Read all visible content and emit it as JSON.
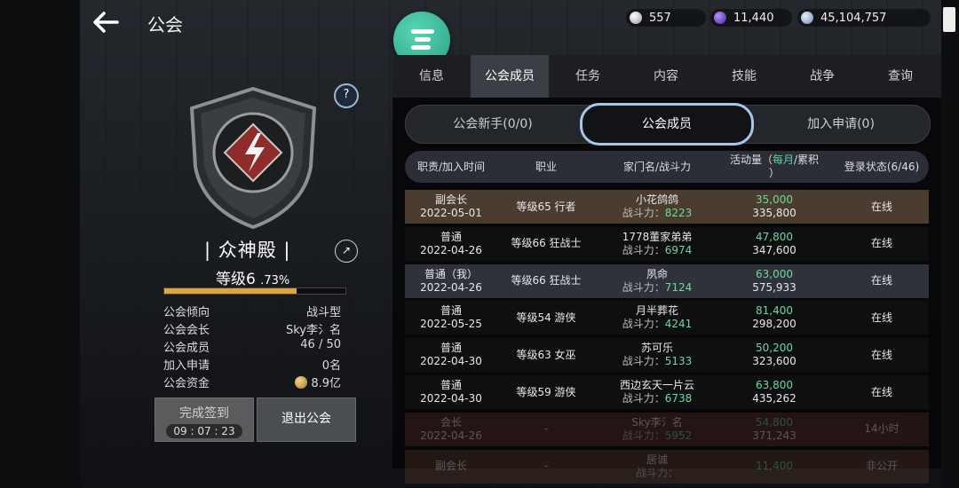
{
  "header": {
    "title": "公会",
    "currencies": [
      {
        "icon": "silver-coin-icon",
        "value": "557",
        "color": "#d8d8d8"
      },
      {
        "icon": "purple-gem-icon",
        "value": "11,440",
        "color": "#7a4bd6"
      },
      {
        "icon": "blue-coin-icon",
        "value": "45,104,757",
        "color": "#a9c0dc"
      }
    ]
  },
  "guild": {
    "name": "| 众神殿 |",
    "level": "等级6",
    "level_pct": ".73%",
    "xp_fraction": 0.73,
    "info": [
      {
        "k": "公会倾向",
        "v": "战斗型"
      },
      {
        "k": "公会会长",
        "v": "Sky李氵名"
      },
      {
        "k": "公会成员",
        "v": "46 / 50"
      },
      {
        "k": "加入申请",
        "v": "0名"
      },
      {
        "k": "公会资金",
        "v": "8.9亿"
      }
    ],
    "checkin_label": "完成签到",
    "checkin_timer": "09 : 07 : 23",
    "leave_label": "退出公会"
  },
  "tabs": [
    "信息",
    "公会成员",
    "任务",
    "内容",
    "技能",
    "战争",
    "查询"
  ],
  "active_tab": 1,
  "subtabs": [
    "公会新手(0/0)",
    "公会成员",
    "加入申请(0)"
  ],
  "columns": {
    "role": "职责/加入时间",
    "job": "职业",
    "family": "家门名/战斗力",
    "activity_a": "活动量（",
    "activity_b": "每月",
    "activity_c": "/累积",
    "activity_d": "）",
    "status": "登录状态(6/46)"
  },
  "power_label": "战斗力：",
  "members": [
    {
      "role": "副会长",
      "date": "2022-05-01",
      "job": "等级65 行者",
      "name": "小花鸽鸽",
      "power": "8223",
      "monthly": "35,000",
      "total": "335,800",
      "status": "在线",
      "bg": "#4a3d30"
    },
    {
      "role": "普通",
      "date": "2022-04-26",
      "job": "等级66 狂战士",
      "name": "1778董家弟弟",
      "power": "6974",
      "monthly": "47,800",
      "total": "347,600",
      "status": "在线",
      "bg": "#0e0f11"
    },
    {
      "role": "普通（我）",
      "date": "2022-04-26",
      "job": "等级66 狂战士",
      "name": "夙命",
      "power": "7124",
      "monthly": "63,000",
      "total": "575,933",
      "status": "在线",
      "bg": "#2f323a"
    },
    {
      "role": "普通",
      "date": "2022-05-25",
      "job": "等级54 游侠",
      "name": "月半葬花",
      "power": "4241",
      "monthly": "81,400",
      "total": "298,200",
      "status": "在线",
      "bg": "#0e0f11"
    },
    {
      "role": "普通",
      "date": "2022-04-30",
      "job": "等级63 女巫",
      "name": "苏可乐",
      "power": "5133",
      "monthly": "50,200",
      "total": "323,600",
      "status": "在线",
      "bg": "#0e0f11"
    },
    {
      "role": "普通",
      "date": "2022-04-30",
      "job": "等级59 游侠",
      "name": "西边玄天一片云",
      "power": "6738",
      "monthly": "63,800",
      "total": "435,262",
      "status": "在线",
      "bg": "#0e0f11"
    },
    {
      "role": "会长",
      "date": "2022-04-26",
      "job": "-",
      "name": "Sky李氵名",
      "power": "5952",
      "monthly": "54,800",
      "total": "371,243",
      "status": "14小时",
      "bg": "#5a2f2a"
    },
    {
      "role": "副会长",
      "date": "",
      "job": "-",
      "name": "居诚",
      "power": "",
      "monthly": "11,400",
      "total": "",
      "status": "非公开",
      "bg": "#5a3a2a"
    }
  ]
}
